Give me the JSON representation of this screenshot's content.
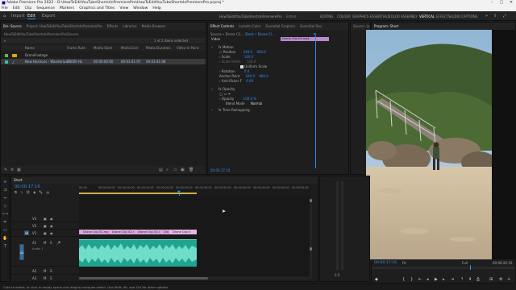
{
  "titlebar": {
    "title": "Adobe Premiere Pro 2022 - D:\\HowToEditYouTubeShorts\\InPremierePro\\HowToEditYouTubeShortsInPremierePro.prproj *",
    "minimize": "–",
    "maximize": "□",
    "close": "✕"
  },
  "menu": [
    "File",
    "Edit",
    "Clip",
    "Sequence",
    "Markers",
    "Graphics and Titles",
    "View",
    "Window",
    "Help"
  ],
  "header": {
    "tabs": [
      "Import",
      "Edit",
      "Export"
    ],
    "active_tab": "Edit",
    "project_path": "HowToEditYouTubeShortsInPremierePro",
    "edited": "- Edited",
    "workspaces": [
      "EDITING",
      "COLOUR",
      "GRAPHICS",
      "ESSENTIALS",
      "COLOR",
      "ASSEMBLY",
      "VERTICAL",
      "EFFECTS",
      "AUDIO",
      "CAPTIONS"
    ],
    "active_workspace": "VERTICAL"
  },
  "project": {
    "tabs": [
      "Bin: Source",
      "Project: HowToEditYouTubeShortsInPremierePro",
      "Effects",
      "Libraries",
      "Media Browser"
    ],
    "path": "HowToEditYouTubeShortsInPremierePro\\Source",
    "items_count": "1 of 2 items selected",
    "columns": [
      "Name",
      "Frame Rate",
      "Media Start",
      "Media End",
      "Media Duration",
      "Video In Point"
    ],
    "items": [
      {
        "name": "DroneFootage",
        "frame_rate": "",
        "start": "",
        "end": "",
        "duration": "",
        "in": ""
      },
      {
        "name": "New Horizons - Wanderlust",
        "frame_rate": "48000 Hz",
        "start": "00:00:00:00",
        "end": "00:03:41:07",
        "duration": "00:03:41:08",
        "in": ""
      }
    ]
  },
  "effect_controls": {
    "tabs": [
      "Effect Controls",
      "Lumetri Color",
      "Essential Graphics",
      "Essential Sou"
    ],
    "source": "Source • Drone Cli...",
    "sequence": "Short • Drone Cl...",
    "clip_label": "Drone Clip 03.mp4",
    "video": "Video",
    "motion": "Motion",
    "position_label": "Position",
    "position_x": "540.0",
    "position_y": "960.0",
    "scale_label": "Scale",
    "scale_value": "100.0",
    "scale_width_label": "Scale Width",
    "scale_width_value": "100.0",
    "uniform_scale": "Uniform Scale",
    "rotation_label": "Rotation",
    "rotation_value": "0.0",
    "anchor_label": "Anchor Point",
    "anchor_x": "540.0",
    "anchor_y": "960.0",
    "flicker_label": "Anti-flicker F",
    "flicker_value": "0.00",
    "opacity": "Opacity",
    "opacity_label": "Opacity",
    "opacity_value": "100.0 %",
    "blend_label": "Blend Mode",
    "blend_value": "Normal",
    "time_remap": "Time Remapping",
    "timecode": "00:00:17:16"
  },
  "source_monitor": {
    "tabs": [
      "Source: (no clips)"
    ]
  },
  "program": {
    "title": "Program: Short",
    "timecode": "00:00:17:16",
    "fit": "Fit",
    "quality": "Full",
    "duration": "00:00:20:16"
  },
  "timeline": {
    "tab": "Short",
    "timecode": "00:00:17:16",
    "ruler": [
      "00:00",
      "00:00:05:00",
      "00:00:10:00",
      "00:00:15:00",
      "00:00:20:00",
      "00:00:25:00",
      "00:00:30:00",
      "00:00:35:00",
      "00:00:40:00",
      "00:00:45:00",
      "00:00:50:00",
      "00:00:55:00"
    ],
    "video_tracks": [
      "V3",
      "V2",
      "V1"
    ],
    "audio_tracks": [
      "A1",
      "A2",
      "A3"
    ],
    "audio_label": "Audio 1",
    "v1_label": "V1",
    "a1_label": "A1",
    "clips": [
      "Drone Clip 01.mp4",
      "Drone Clip 02.mp4",
      "Drone Clip 03.mp4",
      "Dro",
      "Drone Clip 0"
    ],
    "mix_label": "Mix"
  },
  "status_bar": "Click to select, or click in empty space and drag to marquee select. Use Shift, Alt, and Ctrl for other options.",
  "colors": {
    "accent": "#2d8ceb",
    "clip_video": "#d6a9d8",
    "clip_audio": "#2bbfa5",
    "bin": "#e0a800"
  }
}
